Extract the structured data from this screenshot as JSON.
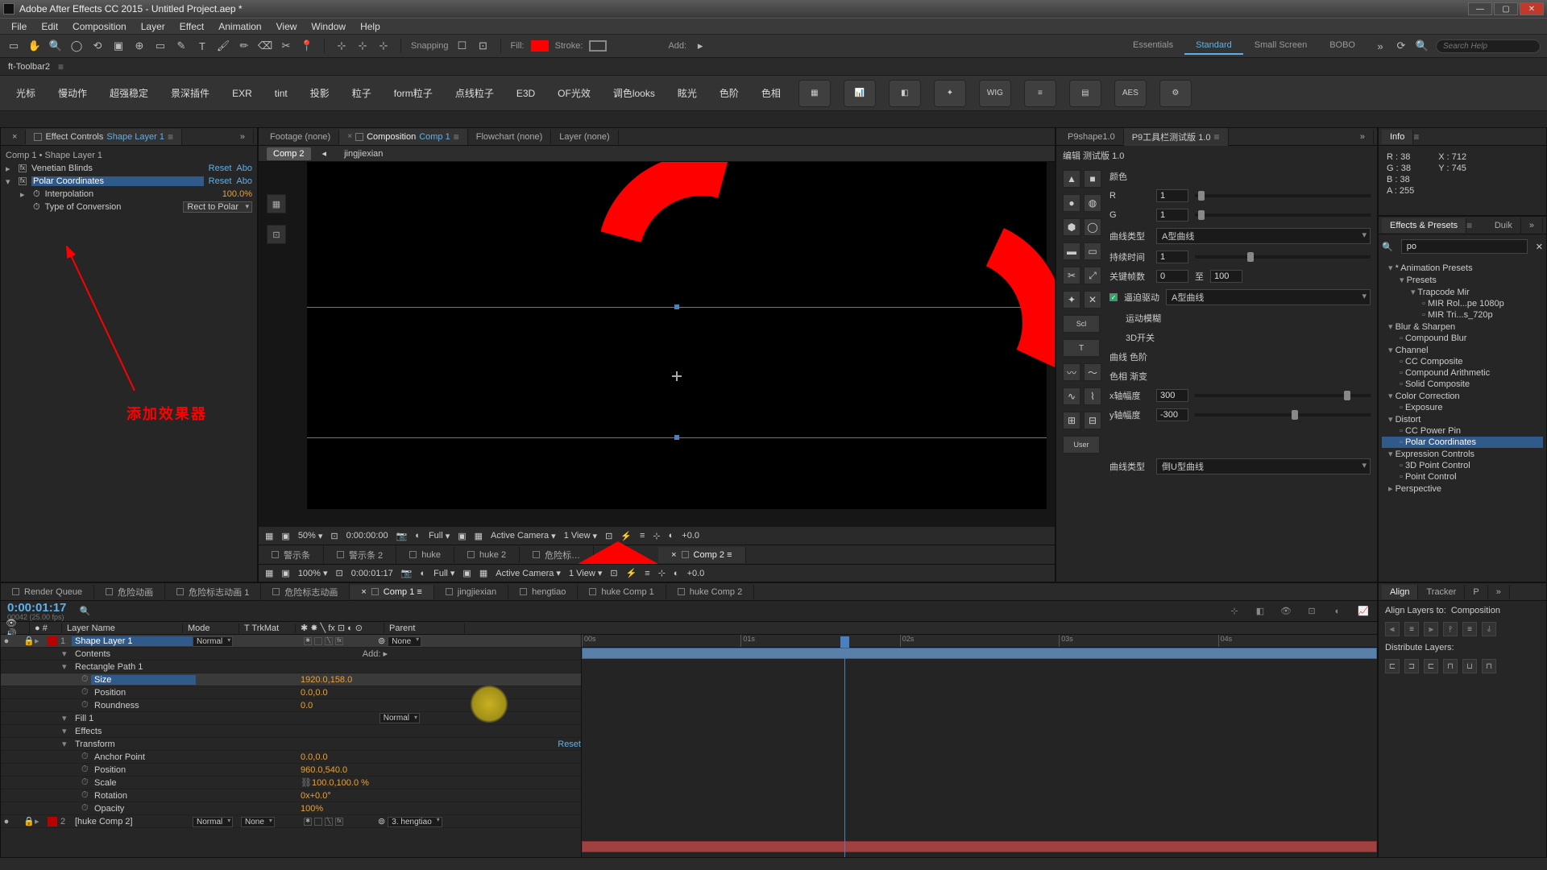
{
  "titlebar": {
    "title": "Adobe After Effects CC 2015 - Untitled Project.aep *"
  },
  "menu": [
    "File",
    "Edit",
    "Composition",
    "Layer",
    "Effect",
    "Animation",
    "View",
    "Window",
    "Help"
  ],
  "toolrow": {
    "snapping": "Snapping",
    "fill": "Fill:",
    "stroke": "Stroke:",
    "add": "Add:",
    "workspaces": [
      "Essentials",
      "Standard",
      "Small Screen",
      "BOBO"
    ],
    "active_ws": "Standard",
    "search_ph": "Search Help"
  },
  "ft": {
    "label": "ft-Toolbar2"
  },
  "plugins": {
    "text_btns": [
      "光标",
      "慢动作",
      "超强稳定",
      "景深插件",
      "EXR",
      "tint",
      "投影",
      "粒子",
      "form粒子",
      "点线粒子",
      "E3D",
      "OF光效",
      "调色looks",
      "眩光",
      "色阶",
      "色相"
    ],
    "icon_btns": [
      "▦",
      "📊",
      "◧",
      "✦",
      "WIG",
      "≡",
      "▤",
      "AES",
      "⚙"
    ]
  },
  "ec": {
    "tab": "Effect Controls",
    "layer_link": "Shape Layer 1",
    "subtitle": "Comp 1 • Shape Layer 1",
    "fx1": {
      "name": "Venetian Blinds",
      "reset": "Reset",
      "about": "Abo"
    },
    "fx2": {
      "name": "Polar Coordinates",
      "reset": "Reset",
      "about": "Abo",
      "p1": {
        "name": "Interpolation",
        "val": "100.0%"
      },
      "p2": {
        "name": "Type of Conversion",
        "val": "Rect to Polar"
      }
    },
    "annotation": "添加效果器"
  },
  "comp": {
    "tabs": [
      {
        "label": "Footage (none)",
        "active": false
      },
      {
        "label": "Composition",
        "sub": "Comp 1",
        "active": true
      },
      {
        "label": "Flowchart (none)",
        "active": false
      },
      {
        "label": "Layer (none)",
        "active": false
      }
    ],
    "breadcrumb": [
      "Comp 2",
      "jingjiexian"
    ],
    "status1": {
      "zoom": "50%",
      "time": "0:00:00:00",
      "res": "Full",
      "view": "Active Camera",
      "vcount": "1 View",
      "exp": "+0.0"
    },
    "bottom_tabs": [
      "警示条",
      "警示条 2",
      "huke",
      "huke 2",
      "危险标…",
      "Comp 2"
    ],
    "active_bottom": "Comp 2",
    "status2": {
      "zoom": "100%",
      "time": "0:00:01:17",
      "res": "Full",
      "view": "Active Camera",
      "vcount": "1 View",
      "exp": "+0.0"
    }
  },
  "p9": {
    "tabs": [
      "P9shape1.0",
      "P9工具栏测试版 1.0"
    ],
    "header": "编辑  测试版 1.0",
    "color_lbl": "颜色",
    "r": "R",
    "g": "G",
    "r_val": "1",
    "g_val": "1",
    "curve_type": "曲线类型",
    "curve_val": "A型曲线",
    "duration": "持续时间",
    "duration_val": "1",
    "keyframes": "关键帧数",
    "kf_val": "0",
    "to": "至",
    "kf_to": "100",
    "auto": "逼迫驱动",
    "auto_val": "A型曲线",
    "motion": "运动模糊",
    "td": "3D开关",
    "cat1": "曲线  色阶",
    "cat2": "色相  渐变",
    "xamp": "x轴幅度",
    "xamp_val": "300",
    "yamp": "y轴幅度",
    "yamp_val": "-300",
    "user": "User",
    "ctype2": "曲线类型",
    "cval2": "倒U型曲线"
  },
  "info": {
    "tab": "Info",
    "r": "R : 38",
    "g": "G : 38",
    "b": "B : 38",
    "a": "A : 255",
    "x": "X : 712",
    "y": "Y : 745"
  },
  "ep": {
    "tab": "Effects & Presets",
    "duik": "Duik",
    "search": "po",
    "tree": [
      {
        "t": "catopen",
        "l": "* Animation Presets"
      },
      {
        "t": "catopen",
        "l": "Presets",
        "pad": 1
      },
      {
        "t": "catopen",
        "l": "Trapcode Mir",
        "pad": 2
      },
      {
        "t": "leaf",
        "l": "MIR Rol...pe 1080p",
        "pad": 3
      },
      {
        "t": "leaf",
        "l": "MIR Tri...s_720p",
        "pad": 3
      },
      {
        "t": "catopen",
        "l": "Blur & Sharpen"
      },
      {
        "t": "leaf",
        "l": "Compound Blur",
        "pad": 1
      },
      {
        "t": "catopen",
        "l": "Channel"
      },
      {
        "t": "leaf",
        "l": "CC Composite",
        "pad": 1
      },
      {
        "t": "leaf",
        "l": "Compound Arithmetic",
        "pad": 1
      },
      {
        "t": "leaf",
        "l": "Solid Composite",
        "pad": 1
      },
      {
        "t": "catopen",
        "l": "Color Correction"
      },
      {
        "t": "leaf",
        "l": "Exposure",
        "pad": 1
      },
      {
        "t": "catopen",
        "l": "Distort"
      },
      {
        "t": "leaf",
        "l": "CC Power Pin",
        "pad": 1
      },
      {
        "t": "leaf",
        "l": "Polar Coordinates",
        "pad": 1,
        "sel": true
      },
      {
        "t": "catopen",
        "l": "Expression Controls"
      },
      {
        "t": "leaf",
        "l": "3D Point Control",
        "pad": 1
      },
      {
        "t": "leaf",
        "l": "Point Control",
        "pad": 1
      },
      {
        "t": "cat",
        "l": "Perspective"
      }
    ]
  },
  "timeline": {
    "tabs": [
      "Render Queue",
      "危险动画",
      "危险标志动画 1",
      "危险标志动画",
      "Comp 1",
      "jingjiexian",
      "hengtiao",
      "huke Comp 1",
      "huke Comp 2"
    ],
    "active_tab": "Comp 1",
    "time": "0:00:01:17",
    "subtime": "00042 (25.00 fps)",
    "cols": {
      "layer": "Layer Name",
      "mode": "Mode",
      "trk": "T  TrkMat",
      "parent": "Parent",
      "add": "Add:"
    },
    "ruler": [
      "00s",
      "01s",
      "02s",
      "03s",
      "04s"
    ],
    "layers": [
      {
        "idx": "1",
        "name": "Shape Layer 1",
        "mode": "Normal",
        "parent": "None",
        "sel": true,
        "color": "#b00"
      },
      {
        "group": "Contents"
      },
      {
        "group": "Rectangle Path 1",
        "open": true
      },
      {
        "prop": "Size",
        "val": "1920.0,158.0",
        "sel": true
      },
      {
        "prop": "Position",
        "val": "0.0,0.0"
      },
      {
        "prop": "Roundness",
        "val": "0.0"
      },
      {
        "group": "Fill 1",
        "mode": "Normal"
      },
      {
        "group": "Effects"
      },
      {
        "group": "Transform",
        "reset": "Reset"
      },
      {
        "prop": "Anchor Point",
        "val": "0.0,0.0"
      },
      {
        "prop": "Position",
        "val": "960.0,540.0"
      },
      {
        "prop": "Scale",
        "val": "100.0,100.0 %",
        "linked": true
      },
      {
        "prop": "Rotation",
        "val": "0x+0.0°"
      },
      {
        "prop": "Opacity",
        "val": "100%"
      },
      {
        "idx": "2",
        "name": "[huke Comp 2]",
        "mode": "Normal",
        "trk": "None",
        "parent": "3. hengtiao",
        "color": "#b00"
      }
    ]
  },
  "align": {
    "tabs": [
      "Align",
      "Tracker",
      "P"
    ],
    "align_to": "Align Layers to:",
    "align_val": "Composition",
    "dist": "Distribute Layers:"
  }
}
